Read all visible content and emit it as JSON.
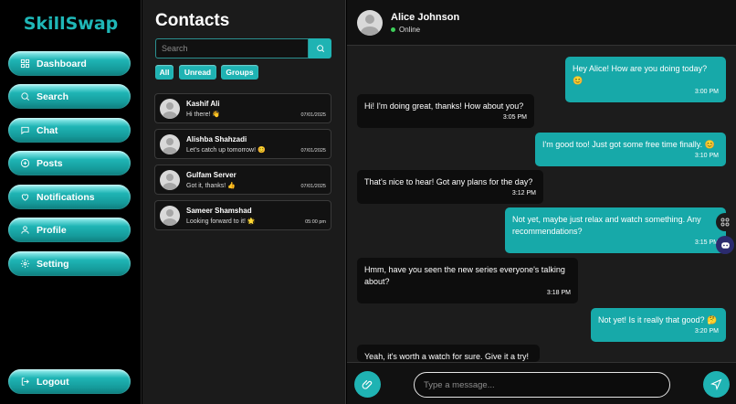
{
  "sidebar": {
    "brand": "SkillSwap",
    "items": [
      {
        "label": "Dashboard",
        "icon": "grid-icon"
      },
      {
        "label": "Search",
        "icon": "search-icon"
      },
      {
        "label": "Chat",
        "icon": "chat-icon"
      },
      {
        "label": "Posts",
        "icon": "plus-circle-icon"
      },
      {
        "label": "Notifications",
        "icon": "heart-icon"
      },
      {
        "label": "Profile",
        "icon": "user-icon"
      },
      {
        "label": "Setting",
        "icon": "gear-icon"
      }
    ],
    "logout": "Logout"
  },
  "contacts": {
    "title": "Contacts",
    "search_placeholder": "Search",
    "filters": [
      "All",
      "Unread",
      "Groups"
    ],
    "list": [
      {
        "name": "Kashif Ali",
        "message": "Hi there! 👋",
        "time": "07/01/2025"
      },
      {
        "name": "Alishba Shahzadi",
        "message": "Let's catch up tomorrow! 😊",
        "time": "07/01/2025"
      },
      {
        "name": "Gulfam Server",
        "message": "Got it, thanks! 👍",
        "time": "07/01/2025"
      },
      {
        "name": "Sameer Shamshad",
        "message": "Looking forward to it! 🌟",
        "time": "05:00 pm"
      }
    ]
  },
  "chat": {
    "contact_name": "Alice Johnson",
    "status": "Online",
    "messages": [
      {
        "type": "sent",
        "text": "Hey Alice! How are you doing today? 😊",
        "time": "3:00 PM"
      },
      {
        "type": "recv",
        "text": "Hi! I'm doing great, thanks! How about you?",
        "time": "3:05 PM"
      },
      {
        "type": "sent",
        "text": "I'm good too! Just got some free time finally. 😊",
        "time": "3:10 PM"
      },
      {
        "type": "recv",
        "text": "That's nice to hear! Got any plans for the day?",
        "time": "3:12 PM"
      },
      {
        "type": "sent",
        "text": "Not yet, maybe just relax and watch something. Any recommendations?",
        "time": "3:15 PM"
      },
      {
        "type": "recv",
        "text": "Hmm, have you seen the new series everyone's talking about?",
        "time": "3:18 PM"
      },
      {
        "type": "sent",
        "text": "Not yet! Is it really that good? 🤔",
        "time": "3:20 PM"
      },
      {
        "type": "recv",
        "text": "Yeah, it's worth a watch for sure. Give it a try!",
        "time": ""
      }
    ],
    "input_placeholder": "Type a message..."
  },
  "colors": {
    "accent": "#1fb3b3",
    "brand": "#1fb7b7",
    "online": "#3ecf5a"
  }
}
